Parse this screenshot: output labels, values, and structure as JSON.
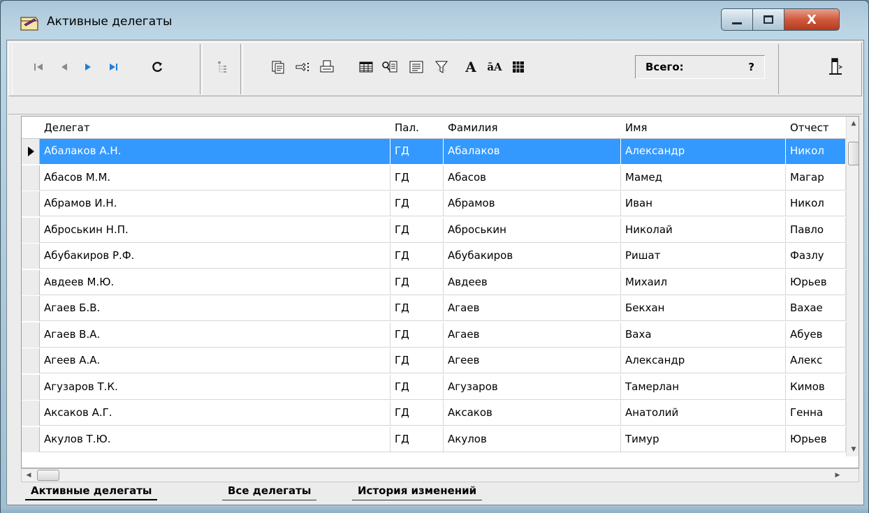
{
  "window": {
    "title": "Активные делегаты",
    "close_glyph": "X",
    "icons": [
      "minimize-icon",
      "maximize-icon",
      "close-icon"
    ]
  },
  "toolbar": {
    "nav_icons": [
      "first-record-icon",
      "prior-record-icon",
      "next-record-icon",
      "last-record-icon",
      "refresh-icon"
    ],
    "tree_icon": "tree-view-icon",
    "action_icons": [
      "copy-record-icon",
      "pointer-list-icon",
      "print-icon",
      "grid-view-icon",
      "find-icon",
      "form-view-icon",
      "filter-icon",
      "font-icon",
      "font-size-icon",
      "columns-icon"
    ],
    "counter_label": "Всего:",
    "counter_value": "?",
    "exit_icon": "exit-door-icon"
  },
  "grid": {
    "columns": [
      "Делегат",
      "Пал.",
      "Фамилия",
      "Имя",
      "Отчест"
    ],
    "rows": [
      {
        "delegate": "Абалаков А.Н.",
        "chamber": "ГД",
        "last": "Абалаков",
        "first": "Александр",
        "middle": "Никол"
      },
      {
        "delegate": "Абасов М.М.",
        "chamber": "ГД",
        "last": "Абасов",
        "first": "Мамед",
        "middle": "Магар"
      },
      {
        "delegate": "Абрамов И.Н.",
        "chamber": "ГД",
        "last": "Абрамов",
        "first": "Иван",
        "middle": "Никол"
      },
      {
        "delegate": "Аброськин Н.П.",
        "chamber": "ГД",
        "last": "Аброськин",
        "first": "Николай",
        "middle": "Павло"
      },
      {
        "delegate": "Абубакиров Р.Ф.",
        "chamber": "ГД",
        "last": "Абубакиров",
        "first": "Ришат",
        "middle": "Фазлу"
      },
      {
        "delegate": "Авдеев М.Ю.",
        "chamber": "ГД",
        "last": "Авдеев",
        "first": "Михаил",
        "middle": "Юрьев"
      },
      {
        "delegate": "Агаев Б.В.",
        "chamber": "ГД",
        "last": "Агаев",
        "first": "Бекхан",
        "middle": "Вахае"
      },
      {
        "delegate": "Агаев В.А.",
        "chamber": "ГД",
        "last": "Агаев",
        "first": "Ваха",
        "middle": "Абуев"
      },
      {
        "delegate": "Агеев А.А.",
        "chamber": "ГД",
        "last": "Агеев",
        "first": "Александр",
        "middle": "Алекс"
      },
      {
        "delegate": "Агузаров Т.К.",
        "chamber": "ГД",
        "last": "Агузаров",
        "first": "Тамерлан",
        "middle": "Кимов"
      },
      {
        "delegate": "Аксаков А.Г.",
        "chamber": "ГД",
        "last": "Аксаков",
        "first": "Анатолий",
        "middle": "Генна"
      },
      {
        "delegate": "Акулов Т.Ю.",
        "chamber": "ГД",
        "last": "Акулов",
        "first": "Тимур",
        "middle": "Юрьев"
      }
    ],
    "selected_row": 0
  },
  "tabs": [
    "Активные делегаты",
    "Все делегаты",
    "История изменений"
  ],
  "active_tab": 0,
  "colors": {
    "selection": "#3399ff",
    "play_accent": "#1e7fd6"
  }
}
